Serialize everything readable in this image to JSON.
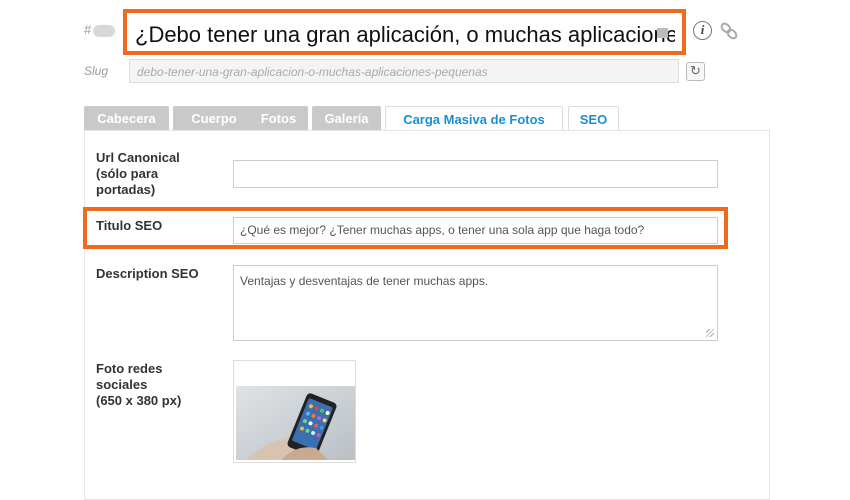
{
  "header": {
    "hash_symbol": "#",
    "title_value": "¿Debo tener una gran aplicación, o muchas aplicacione",
    "info_icon_glyph": "i",
    "slug_label": "Slug",
    "slug_value": "debo-tener-una-gran-aplicacion-o-muchas-aplicaciones-pequenas",
    "refresh_icon_glyph": "↻",
    "highlight_color": "#ee6a1c"
  },
  "tabs": [
    {
      "label": "Cabecera",
      "active": false
    },
    {
      "label": "Cuerpo",
      "active": false
    },
    {
      "label": "Fotos",
      "active": false
    },
    {
      "label": "Galería",
      "active": false
    },
    {
      "label": "Carga Masiva de Fotos",
      "active": true
    },
    {
      "label": "SEO",
      "active": true
    }
  ],
  "form": {
    "canonical": {
      "label_line1": "Url Canonical",
      "label_line2": "(sólo para",
      "label_line3": "portadas)",
      "value": ""
    },
    "seo_title": {
      "label": "Titulo SEO",
      "value": "¿Qué es mejor? ¿Tener muchas apps, o tener una sola app que haga todo?"
    },
    "seo_description": {
      "label": "Description SEO",
      "value": "Ventajas y desventajas de tener muchas apps."
    },
    "social_photo": {
      "label_line1": "Foto redes",
      "label_line2": "sociales",
      "label_line3": "(650 x 380 px)"
    }
  },
  "colors": {
    "accent": "#1a8ed6",
    "inactive_tab": "#c9c9c9"
  }
}
